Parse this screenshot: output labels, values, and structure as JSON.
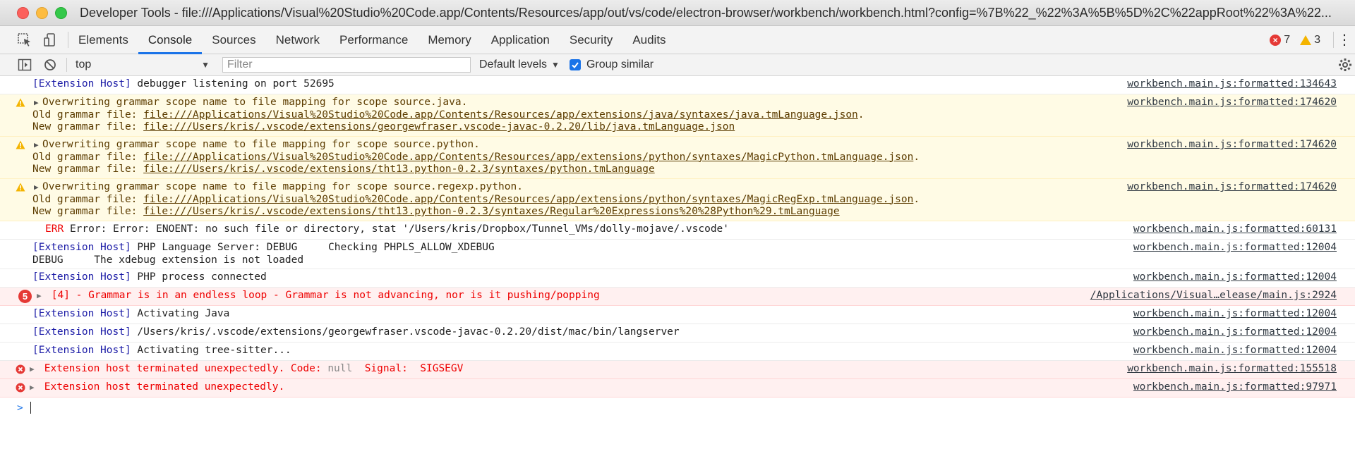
{
  "window": {
    "title": "Developer Tools - file:///Applications/Visual%20Studio%20Code.app/Contents/Resources/app/out/vs/code/electron-browser/workbench/workbench.html?config=%7B%22_%22%3A%5B%5D%2C%22appRoot%22%3A%22..."
  },
  "tabs": [
    "Elements",
    "Console",
    "Sources",
    "Network",
    "Performance",
    "Memory",
    "Application",
    "Security",
    "Audits"
  ],
  "active_tab": "Console",
  "counters": {
    "errors": "7",
    "warnings": "3"
  },
  "toolbar": {
    "context": "top",
    "filter_placeholder": "Filter",
    "levels": "Default levels",
    "group_similar": "Group similar"
  },
  "messages": {
    "m1": {
      "tag": "[Extension Host]",
      "text": "debugger listening on port 52695",
      "src": "workbench.main.js:formatted:134643"
    },
    "m2": {
      "line1": "Overwriting grammar scope name to file mapping for scope source.java.",
      "old_label": "Old grammar file: ",
      "old": "file:///Applications/Visual%20Studio%20Code.app/Contents/Resources/app/extensions/java/syntaxes/java.tmLanguage.json",
      "new_label": "New grammar file: ",
      "new": "file:///Users/kris/.vscode/extensions/georgewfraser.vscode-javac-0.2.20/lib/java.tmLanguage.json",
      "src": "workbench.main.js:formatted:174620"
    },
    "m3": {
      "line1": "Overwriting grammar scope name to file mapping for scope source.python.",
      "old_label": "Old grammar file: ",
      "old": "file:///Applications/Visual%20Studio%20Code.app/Contents/Resources/app/extensions/python/syntaxes/MagicPython.tmLanguage.json",
      "new_label": "New grammar file: ",
      "new": "file:///Users/kris/.vscode/extensions/tht13.python-0.2.3/syntaxes/python.tmLanguage",
      "src": "workbench.main.js:formatted:174620"
    },
    "m4": {
      "line1": "Overwriting grammar scope name to file mapping for scope source.regexp.python.",
      "old_label": "Old grammar file: ",
      "old": "file:///Applications/Visual%20Studio%20Code.app/Contents/Resources/app/extensions/python/syntaxes/MagicRegExp.tmLanguage.json",
      "new_label": "New grammar file: ",
      "new": "file:///Users/kris/.vscode/extensions/tht13.python-0.2.3/syntaxes/Regular%20Expressions%20%28Python%29.tmLanguage",
      "src": "workbench.main.js:formatted:174620"
    },
    "m5": {
      "level": "ERR",
      "text": "Error: Error: ENOENT: no such file or directory, stat '/Users/kris/Dropbox/Tunnel_VMs/dolly-mojave/.vscode'",
      "src": "workbench.main.js:formatted:60131"
    },
    "m6": {
      "tag": "[Extension Host]",
      "text": "PHP Language Server: DEBUG     Checking PHPLS_ALLOW_XDEBUG",
      "line2": "DEBUG     The xdebug extension is not loaded",
      "src": "workbench.main.js:formatted:12004"
    },
    "m7": {
      "tag": "[Extension Host]",
      "text": "PHP process connected",
      "src": "workbench.main.js:formatted:12004"
    },
    "m8": {
      "count": "5",
      "text": "[4] - Grammar is in an endless loop - Grammar is not advancing, nor is it pushing/popping",
      "src": "/Applications/Visual…elease/main.js:2924"
    },
    "m9": {
      "tag": "[Extension Host]",
      "text": "Activating Java",
      "src": "workbench.main.js:formatted:12004"
    },
    "m10": {
      "tag": "[Extension Host]",
      "text": "/Users/kris/.vscode/extensions/georgewfraser.vscode-javac-0.2.20/dist/mac/bin/langserver",
      "src": "workbench.main.js:formatted:12004"
    },
    "m11": {
      "tag": "[Extension Host]",
      "text": "Activating tree-sitter...",
      "src": "workbench.main.js:formatted:12004"
    },
    "m12": {
      "text": "Extension host terminated unexpectedly. Code: ",
      "code": "null",
      "signal_label": "  Signal:  ",
      "signal": "SIGSEGV",
      "src": "workbench.main.js:formatted:155518"
    },
    "m13": {
      "text": "Extension host terminated unexpectedly.",
      "src": "workbench.main.js:formatted:97971"
    }
  },
  "prompt": ">"
}
